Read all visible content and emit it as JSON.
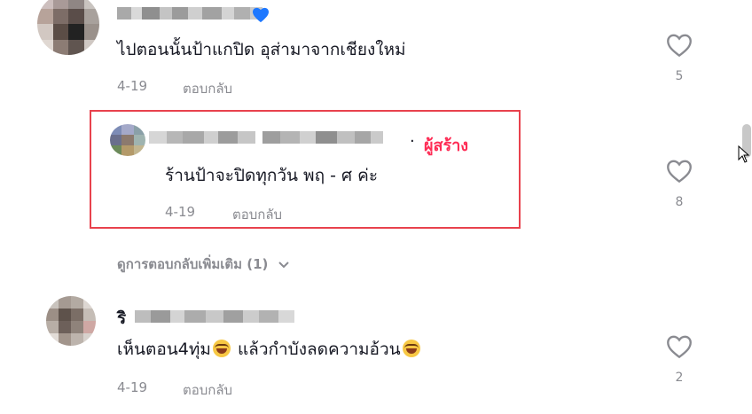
{
  "comments": [
    {
      "text": "ไปตอนนั้นป้าแกปิด อุส่ามาจากเชียงใหม่",
      "date": "4-19",
      "reply_label": "ตอบกลับ",
      "likes": "5",
      "username_blurred": true
    },
    {
      "text": "ร้านป้าจะปิดทุกวัน พฤ - ศ ค่ะ",
      "date": "4-19",
      "reply_label": "ตอบกลับ",
      "likes": "8",
      "creator_badge": "ผู้สร้าง",
      "separator": "·",
      "highlighted": true
    },
    {
      "username_initial": "ริ",
      "text_part1": "เห็นตอน4ทุ่ม",
      "text_part2": "แล้วกำบังลดความอ้วน",
      "date": "4-19",
      "reply_label": "ตอบกลับ",
      "likes": "2"
    }
  ],
  "more_replies": {
    "label": "ดูการตอบกลับเพิ่มเติม (1)",
    "icon": "chevron-down-icon"
  },
  "colors": {
    "creator": "#fe2c55",
    "highlight_border": "#e8424d",
    "muted": "#8a8b91",
    "heart_verified": "#1e78ff"
  }
}
